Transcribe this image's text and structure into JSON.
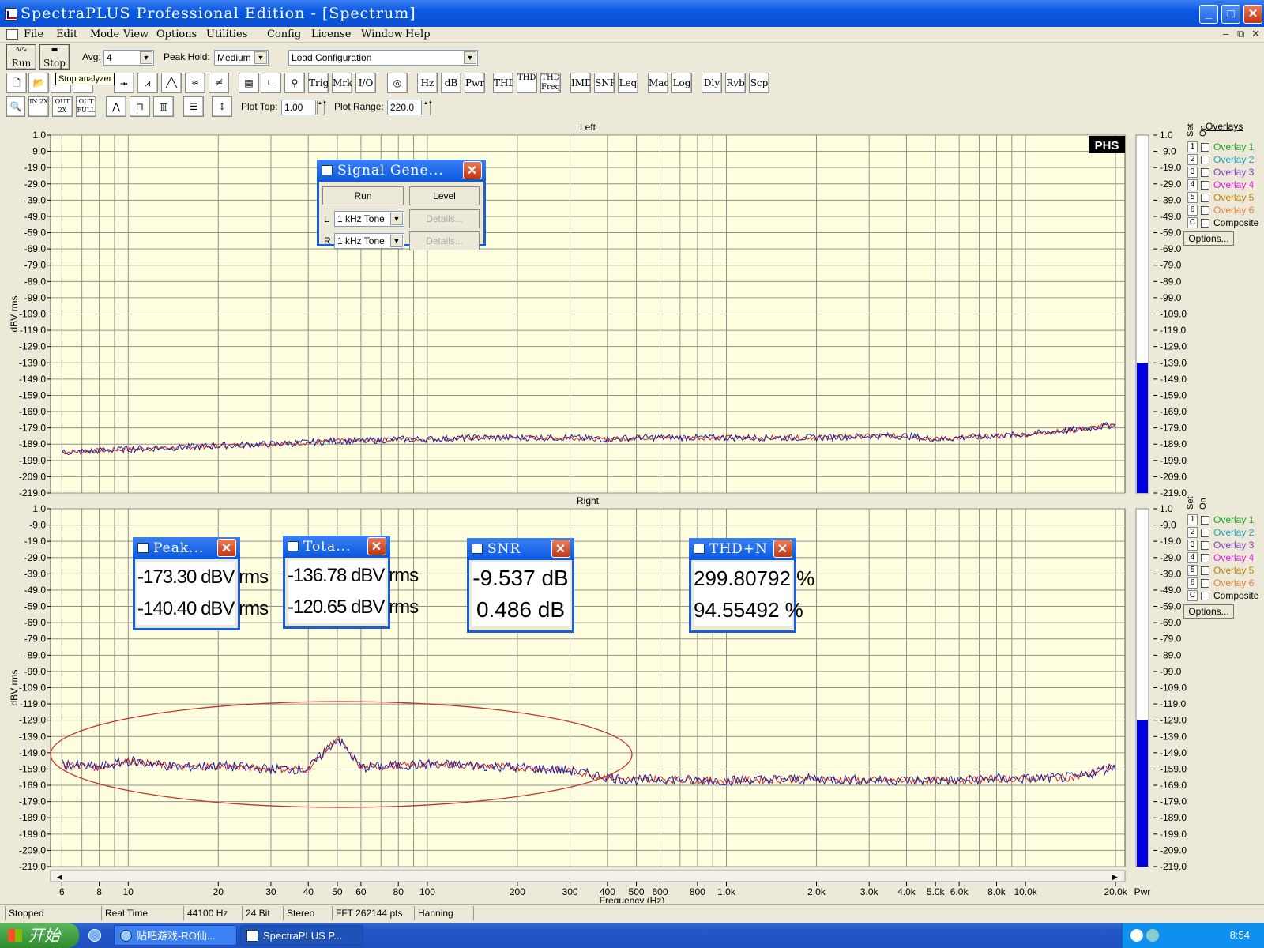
{
  "window": {
    "title": "SpectraPLUS Professional Edition - [Spectrum]"
  },
  "menu": [
    "File",
    "Edit",
    "Mode",
    "View",
    "Options",
    "Utilities",
    "Config",
    "License",
    "Window",
    "Help"
  ],
  "toolbar": {
    "run_label": "Run",
    "stop_label": "Stop",
    "avg_label": "Avg:",
    "avg_value": "4",
    "peak_hold_label": "Peak Hold:",
    "peak_hold_value": "Medium",
    "config_value": "Load Configuration",
    "tooltip": "Stop analyzer",
    "text_buttons": [
      "Trig",
      "Mrk",
      "I/O",
      "Hz",
      "dB",
      "Pwr",
      "THD",
      "THD +N",
      "THD Freq",
      "IMD",
      "SNR",
      "Leq",
      "Mac",
      "Log",
      "Dly",
      "Rvb",
      "Scp"
    ],
    "zoom_buttons": [
      "IN 2X",
      "OUT 2X",
      "OUT FULL"
    ],
    "plot_top_label": "Plot Top:",
    "plot_top_value": "1.00",
    "plot_range_label": "Plot Range:",
    "plot_range_value": "220.0"
  },
  "plots": {
    "left_title": "Left",
    "right_title": "Right",
    "ylabel": "dBV rms",
    "xlabel": "Frequency (Hz)",
    "logo": "PHS",
    "bar_label": "Pwr"
  },
  "overlays": {
    "header": "Overlays",
    "set_label": "Set",
    "on_label": "On",
    "items": [
      {
        "num": "1",
        "label": "Overlay 1",
        "color": "#20A020"
      },
      {
        "num": "2",
        "label": "Overlay 2",
        "color": "#20A0C0"
      },
      {
        "num": "3",
        "label": "Overlay 3",
        "color": "#8040C0"
      },
      {
        "num": "4",
        "label": "Overlay 4",
        "color": "#E020E0"
      },
      {
        "num": "5",
        "label": "Overlay 5",
        "color": "#C08000"
      },
      {
        "num": "6",
        "label": "Overlay 6",
        "color": "#E08040"
      },
      {
        "num": "C",
        "label": "Composite",
        "color": "#000000"
      }
    ],
    "options_label": "Options..."
  },
  "signal_generator": {
    "title": "Signal Gene...",
    "run_label": "Run",
    "level_label": "Level",
    "l_label": "L",
    "r_label": "R",
    "l_value": "1 kHz Tone",
    "r_value": "1 kHz Tone",
    "details_label": "Details..."
  },
  "meters": [
    {
      "title": "Peak...",
      "line1": "-173.30 dBV rms",
      "line2": "-140.40 dBV rms"
    },
    {
      "title": "Tota...",
      "line1": "-136.78 dBV rms",
      "line2": "-120.65 dBV rms"
    },
    {
      "title": "SNR",
      "line1": "-9.537 dB",
      "line2": "0.486 dB"
    },
    {
      "title": "THD+N",
      "line1": "299.80792 %",
      "line2": "94.55492 %"
    }
  ],
  "statusbar": [
    "Stopped",
    "Real Time",
    "44100 Hz",
    "24 Bit",
    "Stereo",
    "FFT 262144 pts",
    "Hanning"
  ],
  "taskbar": {
    "start_label": "开始",
    "tasks": [
      "贴吧游戏-RO仙...",
      "SpectraPLUS P..."
    ],
    "clock": "8:54"
  },
  "colors": {
    "plot_bg": "#FFFFE0",
    "grid": "#909090",
    "trace_blue": "#2020A0",
    "trace_red": "#D02020",
    "level_bar": "#0000E0",
    "annotation_ellipse": "#C83030"
  },
  "chart_data": {
    "type": "line",
    "x_scale": "log",
    "xlim": [
      5.5,
      21500
    ],
    "ylim": [
      -219,
      1
    ],
    "x_ticks": [
      6,
      8,
      10,
      20,
      30,
      40,
      50,
      60,
      80,
      100,
      200,
      300,
      400,
      500,
      600,
      800,
      1000,
      2000,
      3000,
      4000,
      5000,
      6000,
      8000,
      10000,
      20000
    ],
    "x_tick_labels": [
      "6",
      "8",
      "10",
      "20",
      "30",
      "40",
      "50",
      "60",
      "80",
      "100",
      "200",
      "300",
      "400",
      "500",
      "600",
      "800",
      "1.0k",
      "2.0k",
      "3.0k",
      "4.0k",
      "5.0k",
      "6.0k",
      "8.0k",
      "10.0k",
      "20.0k"
    ],
    "y_ticks": [
      1.0,
      -9.0,
      -19.0,
      -29.0,
      -39.0,
      -49.0,
      -59.0,
      -69.0,
      -79.0,
      -89.0,
      -99.0,
      -109.0,
      -119.0,
      -129.0,
      -139.0,
      -149.0,
      -159.0,
      -169.0,
      -179.0,
      -189.0,
      -199.0,
      -209.0,
      -219.0
    ],
    "y_tick_labels": [
      "1.0",
      "-9.0",
      "-19.0",
      "-29.0",
      "-39.0",
      "-49.0",
      "-59.0",
      "-69.0",
      "-79.0",
      "-89.0",
      "-99.0",
      "-109.0",
      "-119.0",
      "-129.0",
      "-139.0",
      "-149.0",
      "-159.0",
      "-169.0",
      "-179.0",
      "-189.0",
      "-199.0",
      "-209.0",
      "-219.0"
    ],
    "grid": true,
    "panels": [
      {
        "name": "Left",
        "x": [
          6,
          8,
          10,
          15,
          20,
          30,
          40,
          50,
          60,
          80,
          100,
          150,
          200,
          300,
          400,
          500,
          600,
          800,
          1000,
          2000,
          3000,
          4000,
          5000,
          6000,
          8000,
          10000,
          15000,
          20000
        ],
        "y": [
          -194,
          -193,
          -192,
          -191,
          -190,
          -189,
          -188,
          -187,
          -187,
          -186,
          -186,
          -185,
          -185,
          -185,
          -186,
          -185,
          -185,
          -185,
          -185,
          -185,
          -184,
          -184,
          -186,
          -185,
          -184,
          -183,
          -180,
          -177
        ],
        "level_bar": -139
      },
      {
        "name": "Right",
        "x": [
          6,
          8,
          10,
          15,
          20,
          30,
          40,
          50,
          60,
          80,
          100,
          150,
          200,
          300,
          400,
          500,
          600,
          800,
          1000,
          2000,
          3000,
          4000,
          5000,
          6000,
          8000,
          10000,
          15000,
          20000
        ],
        "y": [
          -156,
          -158,
          -154,
          -158,
          -157,
          -159,
          -159,
          -140,
          -158,
          -157,
          -156,
          -157,
          -158,
          -160,
          -164,
          -166,
          -165,
          -166,
          -166,
          -165,
          -166,
          -166,
          -166,
          -166,
          -165,
          -165,
          -164,
          -157
        ],
        "level_bar": -129
      }
    ]
  }
}
